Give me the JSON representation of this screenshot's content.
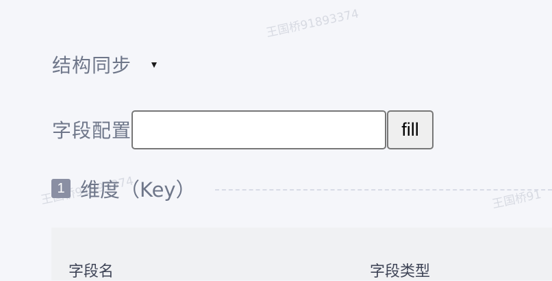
{
  "watermark": {
    "text_top": "王国桥91893374",
    "text_left": "王国桥91893374",
    "text_right": "王国桥91"
  },
  "sync": {
    "label": "结构同步",
    "caret_icon": "caret-down-icon"
  },
  "field_config": {
    "label": "字段配置",
    "input_value": "",
    "button_label": "fill"
  },
  "section": {
    "index": "1",
    "title": "维度（Key）"
  },
  "table": {
    "columns": [
      "字段名",
      "字段类型"
    ]
  }
}
